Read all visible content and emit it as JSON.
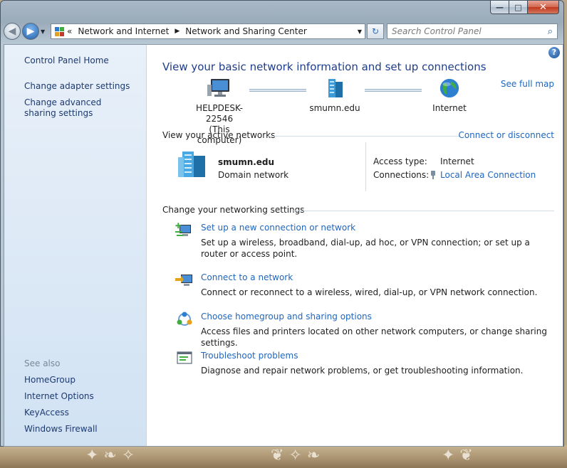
{
  "window": {
    "minimize_glyph": "—",
    "maximize_glyph": "□",
    "close_glyph": "✕"
  },
  "nav": {
    "back_glyph": "◀",
    "forward_glyph": "▶",
    "history_dropdown_glyph": "▼",
    "breadcrumb_prefix": "«",
    "breadcrumb": [
      "Network and Internet",
      "Network and Sharing Center"
    ],
    "breadcrumb_separator": "▶",
    "address_dropdown_glyph": "▼",
    "refresh_glyph": "↻",
    "search_placeholder": "Search Control Panel",
    "search_icon_glyph": "⌕"
  },
  "sidebar": {
    "home": "Control Panel Home",
    "links": [
      "Change adapter settings",
      "Change advanced sharing settings"
    ],
    "see_also_label": "See also",
    "see_also": [
      "HomeGroup",
      "Internet Options",
      "KeyAccess",
      "Windows Firewall"
    ]
  },
  "main": {
    "help_glyph": "?",
    "heading": "View your basic network information and set up connections",
    "see_full_map": "See full map",
    "map": {
      "computer_name": "HELPDESK-22546",
      "computer_sub": "(This computer)",
      "domain": "smumn.edu",
      "internet": "Internet"
    },
    "active_networks": {
      "title": "View your active networks",
      "connect_link": "Connect or disconnect",
      "name": "smumn.edu",
      "type": "Domain network",
      "access_type_label": "Access type:",
      "access_type_value": "Internet",
      "connections_label": "Connections:",
      "connections_value": "Local Area Connection"
    },
    "settings": {
      "title": "Change your networking settings",
      "tasks": [
        {
          "icon": "new-connection-icon",
          "link": "Set up a new connection or network",
          "desc": "Set up a wireless, broadband, dial-up, ad hoc, or VPN connection; or set up a router or access point."
        },
        {
          "icon": "connect-network-icon",
          "link": "Connect to a network",
          "desc": "Connect or reconnect to a wireless, wired, dial-up, or VPN network connection."
        },
        {
          "icon": "homegroup-icon",
          "link": "Choose homegroup and sharing options",
          "desc": "Access files and printers located on other network computers, or change sharing settings."
        },
        {
          "icon": "troubleshoot-icon",
          "link": "Troubleshoot problems",
          "desc": "Diagnose and repair network problems, or get troubleshooting information."
        }
      ]
    }
  },
  "colors": {
    "link": "#1e66bf",
    "heading": "#1e3d8a",
    "sidebar_link": "#1c3a70",
    "sidebar_bg": "#dde9f6"
  }
}
